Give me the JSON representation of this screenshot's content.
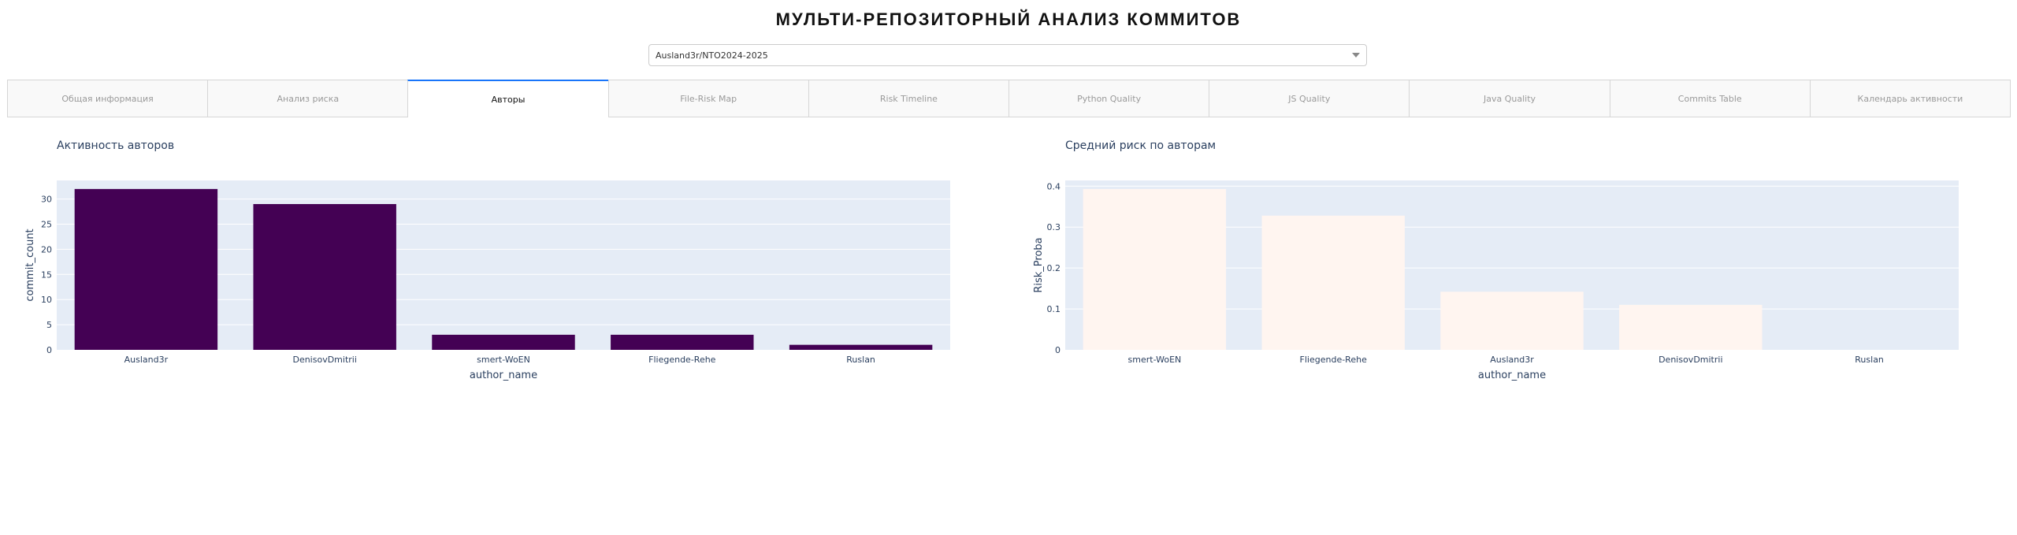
{
  "header": {
    "title": "МУЛЬТИ-РЕПОЗИТОРНЫЙ АНАЛИЗ КОММИТОВ"
  },
  "repo_selector": {
    "selected": "Ausland3r/NTO2024-2025"
  },
  "tabs": [
    {
      "label": "Общая информация",
      "active": false
    },
    {
      "label": "Анализ риска",
      "active": false
    },
    {
      "label": "Авторы",
      "active": true
    },
    {
      "label": "File-Risk Map",
      "active": false
    },
    {
      "label": "Risk Timeline",
      "active": false
    },
    {
      "label": "Python Quality",
      "active": false
    },
    {
      "label": "JS Quality",
      "active": false
    },
    {
      "label": "Java Quality",
      "active": false
    },
    {
      "label": "Commits Table",
      "active": false
    },
    {
      "label": "Календарь активности",
      "active": false
    }
  ],
  "colors": {
    "plot_bg": "#e5ecf6",
    "activity_bar": "#440154",
    "risk_bar": "#fff5f0",
    "accent": "#1975fa"
  },
  "chart_data": [
    {
      "type": "bar",
      "title": "Активность авторов",
      "xlabel": "author_name",
      "ylabel": "commit_count",
      "categories": [
        "Ausland3r",
        "DenisovDmitrii",
        "smert-WoEN",
        "Fliegende-Rehe",
        "Ruslan"
      ],
      "values": [
        32,
        29,
        3,
        3,
        1
      ],
      "ylim": [
        0,
        33.7
      ],
      "yticks": [
        0,
        5,
        10,
        15,
        20,
        25,
        30
      ],
      "ytick_labels": [
        "0",
        "5",
        "10",
        "15",
        "20",
        "25",
        "30"
      ],
      "grid": true
    },
    {
      "type": "bar",
      "title": "Средний риск по авторам",
      "xlabel": "author_name",
      "ylabel": "Risk_Proba",
      "categories": [
        "smert-WoEN",
        "Fliegende-Rehe",
        "Ausland3r",
        "DenisovDmitrii",
        "Ruslan"
      ],
      "values": [
        0.393,
        0.328,
        0.142,
        0.11,
        0.0
      ],
      "ylim": [
        0,
        0.414
      ],
      "yticks": [
        0,
        0.1,
        0.2,
        0.3,
        0.4
      ],
      "ytick_labels": [
        "0",
        "0.1",
        "0.2",
        "0.3",
        "0.4"
      ],
      "grid": true
    }
  ]
}
